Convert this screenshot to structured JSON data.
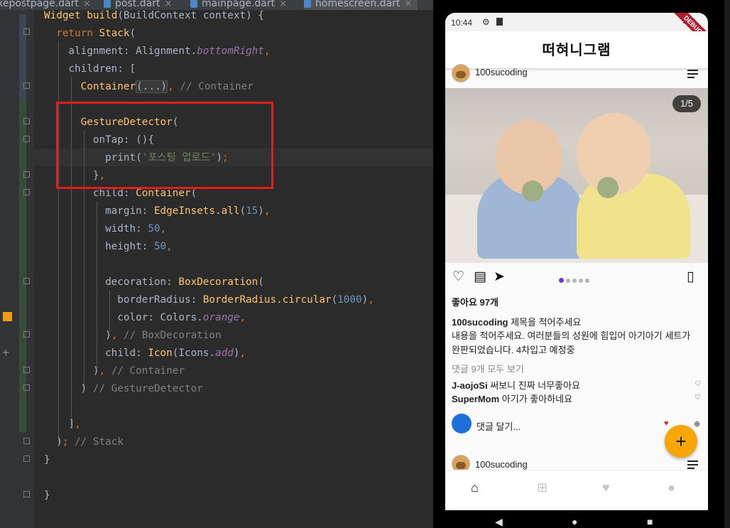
{
  "ide": {
    "tabs": [
      {
        "label": "xepostpage.dart",
        "close": "×"
      },
      {
        "label": "post.dart",
        "close": "×"
      },
      {
        "label": "mainpage.dart",
        "close": "×"
      },
      {
        "label": "homescreen.dart",
        "close": "×"
      }
    ],
    "code_lines": [
      "Widget build(BuildContext context) {",
      "  return Stack(",
      "    alignment: Alignment.bottomRight,",
      "    children: [",
      "      Container(...), // Container",
      "",
      "      GestureDetector(",
      "        onTap: (){",
      "          print('포스팅 업로드');",
      "        },",
      "        child: Container(",
      "          margin: EdgeInsets.all(15),",
      "          width: 50,",
      "          height: 50,",
      "",
      "          decoration: BoxDecoration(",
      "            borderRadius: BorderRadius.circular(1000),",
      "            color: Colors.orange,",
      "          ), // BoxDecoration",
      "          child: Icon(Icons.add),",
      "        ), // Container",
      "      ) // GestureDetector",
      "",
      "    ],",
      "  ); // Stack",
      "}",
      "",
      "}"
    ]
  },
  "phone": {
    "status_time": "10:44",
    "debug_banner": "DEBUG",
    "app_title": "떠혀니그램",
    "post_user": "100sucoding",
    "page_indicator": "1/5",
    "likes": "좋아요 97개",
    "caption_user": "100sucoding",
    "caption_title": "제목을 적어주세요",
    "caption_body_1": "내용을 적어주세요. 여러분들의 성원에 힘입어 아기아기 세트가",
    "caption_body_2": "완판되었습니다. 4차입고 예정중",
    "view_comments": "댓글 9개 모두 보기",
    "comments": [
      {
        "user": "J-aojoSi",
        "text": "써보니 진짜 너무좋아요"
      },
      {
        "user": "SuperMom",
        "text": "아기가 좋아하네요"
      }
    ],
    "comment_placeholder": "댓글 달기...",
    "next_post_user": "100sucoding",
    "fab_icon": "+"
  },
  "colors": {
    "fab": "#f7a608",
    "active_dot": "#6a3bd8",
    "highlight_box": "#e31d1d"
  }
}
